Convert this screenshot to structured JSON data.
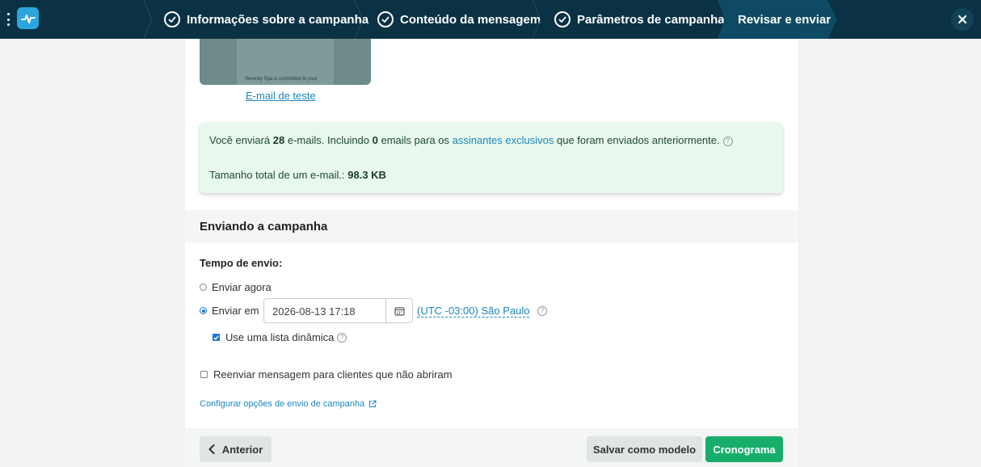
{
  "steps": [
    {
      "label": "Informações sobre a campanha",
      "done": true
    },
    {
      "label": "Conteúdo da mensagem",
      "done": true
    },
    {
      "label": "Parâmetros de campanha",
      "done": true
    },
    {
      "label": "Revisar e enviar",
      "done": false,
      "active": true
    }
  ],
  "preview": {
    "tiny_text": "Serenity Spa is committed to your"
  },
  "test_email_link": "E-mail de teste",
  "summary": {
    "line1_pre": "Você enviará ",
    "email_count": "28",
    "line1_mid": " e-mails.  Incluindo ",
    "exclusive_count": "0",
    "line1_mid2": " emails para os ",
    "exclusive_link": "assinantes exclusivos",
    "line1_post": " que foram enviados anteriormente.",
    "size_label": "Tamanho total de um e-mail.: ",
    "size_value": "98.3 KB"
  },
  "section_title": "Enviando a campanha",
  "send_time": {
    "label": "Tempo de envio:",
    "now_label": "Enviar agora",
    "at_label": "Enviar em",
    "date_value": "2026-08-13 17:18",
    "timezone": "(UTC -03:00) São Paulo",
    "dynamic_list_label": "Use uma lista dinâmica"
  },
  "resend_label": "Reenviar mensagem para clientes que não abriram",
  "config_link": "Configurar opções de envio de campanha",
  "buttons": {
    "previous": "Anterior",
    "save_template": "Salvar como modelo",
    "schedule": "Cronograma"
  },
  "colors": {
    "header": "#0a3244",
    "accent": "#17ae6b",
    "link": "#1a86c0",
    "summary_bg": "#e9f8ec"
  }
}
